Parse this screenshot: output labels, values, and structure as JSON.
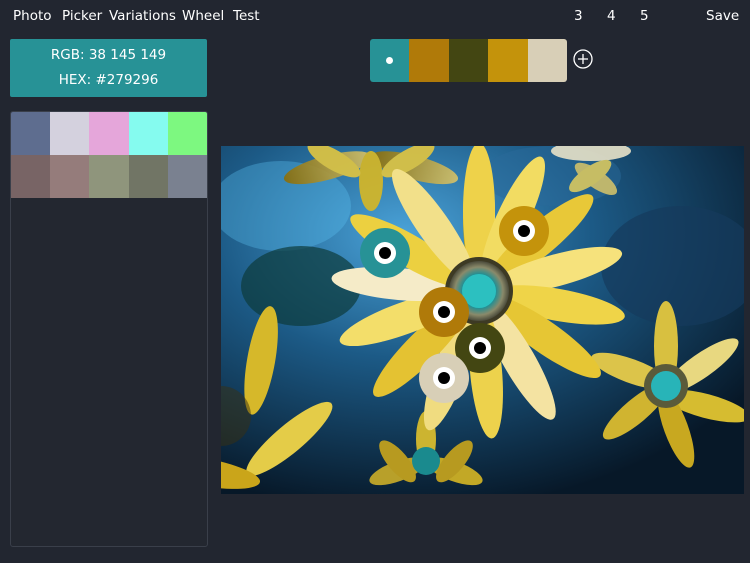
{
  "nav": {
    "items": [
      {
        "label": "Photo"
      },
      {
        "label": "Picker"
      },
      {
        "label": "Variations"
      },
      {
        "label": "Wheel"
      },
      {
        "label": "Test"
      }
    ],
    "counts": [
      "3",
      "4",
      "5"
    ],
    "save_label": "Save"
  },
  "selected_color": {
    "rgb_text": "RGB: 38 145 149",
    "hex_text": "HEX: #279296",
    "hex": "#279296"
  },
  "swatches": {
    "row1": [
      "#5e6d8f",
      "#d4d1de",
      "#e5a6da",
      "#85fbef",
      "#7df880"
    ],
    "row2": [
      "#786465",
      "#957c7b",
      "#8f957c",
      "#717565",
      "#7a8190"
    ]
  },
  "palette": {
    "colors": [
      "#279296",
      "#b07a09",
      "#434612",
      "#c4930b",
      "#d8cfb7"
    ],
    "selected_index": 0,
    "add_icon": "plus-circle-icon"
  },
  "photo": {
    "description_icon": "flower-photo",
    "markers": [
      {
        "name": "marker-teal",
        "color": "#279296"
      },
      {
        "name": "marker-amber-top",
        "color": "#c4930b"
      },
      {
        "name": "marker-amber-center",
        "color": "#b07a09"
      },
      {
        "name": "marker-olive",
        "color": "#434612"
      },
      {
        "name": "marker-beige",
        "color": "#d8cfb7"
      }
    ]
  }
}
